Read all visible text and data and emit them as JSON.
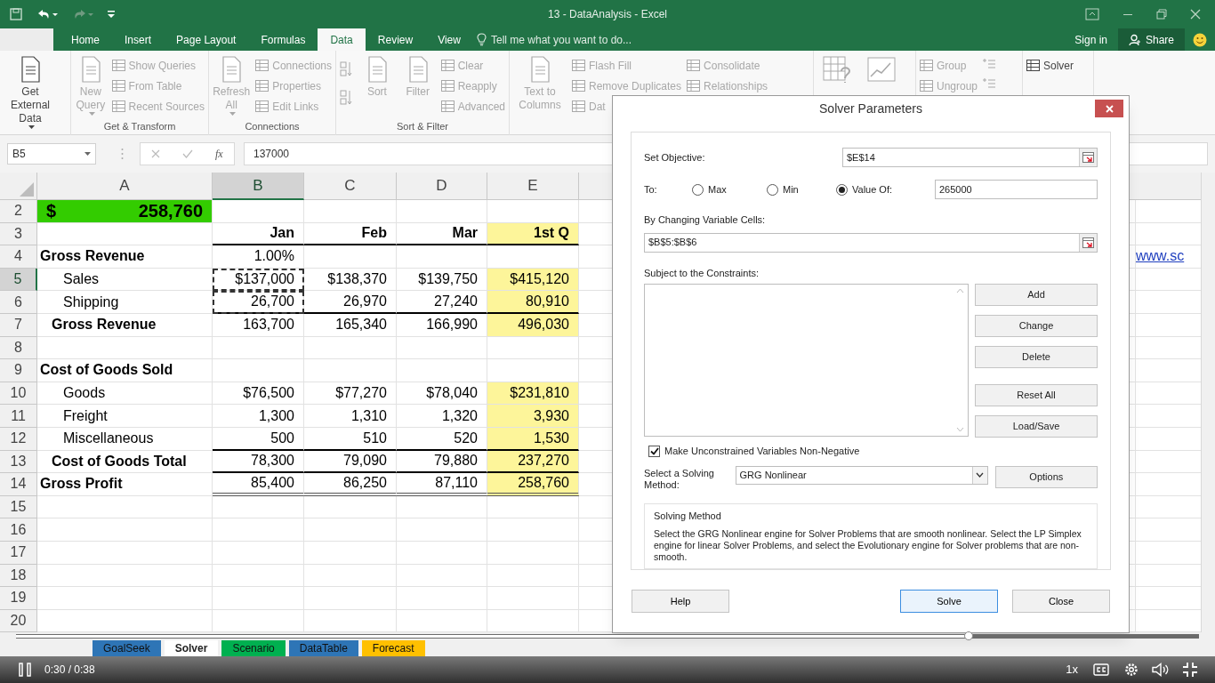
{
  "window": {
    "title": "13 - DataAnalysis - Excel"
  },
  "ribbon_tabs": [
    {
      "label": "Home",
      "selected": false
    },
    {
      "label": "Insert",
      "selected": false
    },
    {
      "label": "Page Layout",
      "selected": false
    },
    {
      "label": "Formulas",
      "selected": false
    },
    {
      "label": "Data",
      "selected": true
    },
    {
      "label": "Review",
      "selected": false
    },
    {
      "label": "View",
      "selected": false
    }
  ],
  "tell_me": "Tell me what you want to do...",
  "sign_in": "Sign in",
  "share": "Share",
  "ribbon_groups": [
    {
      "disabled": false,
      "items": [
        {
          "kind": "large",
          "text": "Get External Data",
          "menu": true
        }
      ]
    },
    {
      "label": "Get & Transform",
      "disabled": true,
      "items": [
        {
          "kind": "large",
          "text": "New Query",
          "menu": true
        },
        {
          "kind": "column",
          "entries": [
            "Show Queries",
            "From Table",
            "Recent Sources"
          ]
        }
      ]
    },
    {
      "label": "Connections",
      "disabled": true,
      "items": [
        {
          "kind": "large",
          "text": "Refresh All",
          "menu": true
        },
        {
          "kind": "column",
          "entries": [
            "Connections",
            "Properties",
            "Edit Links"
          ]
        }
      ]
    },
    {
      "label": "Sort & Filter",
      "disabled": true,
      "items": [
        {
          "kind": "sort_icons"
        },
        {
          "kind": "large",
          "text": "Sort",
          "menu": false
        },
        {
          "kind": "large",
          "text": "Filter",
          "menu": false
        },
        {
          "kind": "column",
          "entries": [
            "Clear",
            "Reapply",
            "Advanced"
          ]
        }
      ]
    },
    {
      "disabled": true,
      "items": [
        {
          "kind": "large",
          "text": "Text to Columns",
          "menu": false
        },
        {
          "kind": "column",
          "entries": [
            "Flash Fill",
            "Remove Duplicates",
            "Dat"
          ]
        },
        {
          "kind": "column",
          "entries": [
            "Consolidate",
            "Relationships"
          ]
        }
      ]
    },
    {
      "disabled": true,
      "items": [
        {
          "kind": "chart_icons"
        }
      ]
    },
    {
      "disabled": true,
      "items": [
        {
          "kind": "column",
          "entries": [
            "Group",
            "Ungroup"
          ]
        },
        {
          "kind": "outline_icons"
        }
      ]
    },
    {
      "disabled": false,
      "items": [
        {
          "kind": "column",
          "entries": [
            "Solver"
          ]
        }
      ]
    }
  ],
  "name_box": "B5",
  "function_button": "fx",
  "formula": "137000",
  "columns": [
    {
      "label": "A",
      "selected": false
    },
    {
      "label": "B",
      "selected": true
    },
    {
      "label": "C",
      "selected": false
    },
    {
      "label": "D",
      "selected": false
    },
    {
      "label": "E",
      "selected": false
    }
  ],
  "rows": [
    {
      "number": "2",
      "selected": false,
      "kind": "kpi",
      "highlight": false,
      "marked": false,
      "underline": false,
      "double": false,
      "cells": [
        {
          "sym": "$",
          "v": "258,760"
        }
      ]
    },
    {
      "number": "3",
      "selected": false,
      "kind": "header",
      "highlight": true,
      "marked": false,
      "underline": true,
      "double": false,
      "cells": [
        "",
        "Jan",
        "Feb",
        "Mar",
        "1st Q"
      ]
    },
    {
      "number": "4",
      "selected": false,
      "kind": "section",
      "highlight": false,
      "marked": false,
      "underline": false,
      "double": false,
      "link": "www.sc",
      "cells": [
        "Gross Revenue",
        "1.00%",
        "",
        "",
        ""
      ]
    },
    {
      "number": "5",
      "selected": true,
      "kind": "item",
      "highlight": true,
      "marked": true,
      "underline": false,
      "double": false,
      "cells": [
        "Sales",
        {
          "sym": "$",
          "v": "137,000"
        },
        {
          "sym": "$",
          "v": "138,370"
        },
        {
          "sym": "$",
          "v": "139,750"
        },
        {
          "sym": "$",
          "v": "415,120"
        }
      ]
    },
    {
      "number": "6",
      "selected": false,
      "kind": "item",
      "highlight": true,
      "marked": true,
      "underline": true,
      "double": false,
      "cells": [
        "Shipping",
        "26,700",
        "26,970",
        "27,240",
        "80,910"
      ]
    },
    {
      "number": "7",
      "selected": false,
      "kind": "total",
      "highlight": true,
      "marked": false,
      "underline": false,
      "double": false,
      "cells": [
        "Gross Revenue",
        "163,700",
        "165,340",
        "166,990",
        "496,030"
      ]
    },
    {
      "number": "8",
      "selected": false,
      "kind": "item",
      "highlight": false,
      "marked": false,
      "underline": false,
      "double": false,
      "cells": []
    },
    {
      "number": "9",
      "selected": false,
      "kind": "section",
      "highlight": false,
      "marked": false,
      "underline": false,
      "double": false,
      "cells": [
        "Cost of Goods Sold"
      ]
    },
    {
      "number": "10",
      "selected": false,
      "kind": "item",
      "highlight": true,
      "marked": false,
      "underline": false,
      "double": false,
      "cells": [
        "Goods",
        {
          "sym": "$",
          "v": "76,500"
        },
        {
          "sym": "$",
          "v": "77,270"
        },
        {
          "sym": "$",
          "v": "78,040"
        },
        {
          "sym": "$",
          "v": "231,810"
        }
      ]
    },
    {
      "number": "11",
      "selected": false,
      "kind": "item",
      "highlight": true,
      "marked": false,
      "underline": false,
      "double": false,
      "cells": [
        "Freight",
        "1,300",
        "1,310",
        "1,320",
        "3,930"
      ]
    },
    {
      "number": "12",
      "selected": false,
      "kind": "item",
      "highlight": true,
      "marked": false,
      "underline": true,
      "double": false,
      "cells": [
        "Miscellaneous",
        "500",
        "510",
        "520",
        "1,530"
      ]
    },
    {
      "number": "13",
      "selected": false,
      "kind": "total",
      "highlight": true,
      "marked": false,
      "underline": true,
      "double": false,
      "cells": [
        "Cost of Goods Total",
        "78,300",
        "79,090",
        "79,880",
        "237,270"
      ]
    },
    {
      "number": "14",
      "selected": false,
      "kind": "section",
      "highlight": true,
      "marked": false,
      "underline": true,
      "double": true,
      "cells": [
        "Gross Profit",
        "85,400",
        "86,250",
        "87,110",
        "258,760"
      ]
    },
    {
      "number": "15",
      "selected": false,
      "kind": "item",
      "highlight": false,
      "marked": false,
      "underline": false,
      "double": false,
      "cells": []
    },
    {
      "number": "16",
      "selected": false,
      "kind": "item",
      "highlight": false,
      "marked": false,
      "underline": false,
      "double": false,
      "cells": []
    },
    {
      "number": "17",
      "selected": false,
      "kind": "item",
      "highlight": false,
      "marked": false,
      "underline": false,
      "double": false,
      "cells": []
    },
    {
      "number": "18",
      "selected": false,
      "kind": "item",
      "highlight": false,
      "marked": false,
      "underline": false,
      "double": false,
      "cells": []
    },
    {
      "number": "19",
      "selected": false,
      "kind": "item",
      "highlight": false,
      "marked": false,
      "underline": false,
      "double": false,
      "cells": []
    },
    {
      "number": "20",
      "selected": false,
      "kind": "item",
      "highlight": false,
      "marked": false,
      "underline": false,
      "double": false,
      "cells": []
    }
  ],
  "sheet_tabs": [
    {
      "label": "GoalSeek",
      "selected": false,
      "color": "#2e75b6"
    },
    {
      "label": "Solver",
      "selected": true
    },
    {
      "label": "Scenario",
      "selected": false,
      "color": "#00b050"
    },
    {
      "label": "DataTable",
      "selected": false,
      "color": "#2e75b6"
    },
    {
      "label": "Forecast",
      "selected": false,
      "color": "#ffc000"
    }
  ],
  "dialog": {
    "title": "Solver Parameters",
    "objective_label": "Set Objective:",
    "objective": "$E$14",
    "to_label": "To:",
    "targets": [
      {
        "label": "Max",
        "selected": false
      },
      {
        "label": "Min",
        "selected": false
      },
      {
        "label": "Value Of:",
        "selected": true
      }
    ],
    "target_value": "265000",
    "variables_label": "By Changing Variable Cells:",
    "variables": "$B$5:$B$6",
    "constraints_label": "Subject to the Constraints:",
    "constraint_buttons": [
      "Add",
      "Change",
      "Delete",
      "Reset All",
      "Load/Save"
    ],
    "nonnegative": {
      "label": "Make Unconstrained Variables Non-Negative",
      "checked": true
    },
    "method_label": "Select a Solving Method:",
    "method": "GRG Nonlinear",
    "options_button": "Options",
    "method_box": {
      "title": "Solving Method",
      "text": "Select the GRG Nonlinear engine for Solver Problems that are smooth nonlinear. Select the LP Simplex engine for linear Solver Problems, and select the Evolutionary engine for Solver problems that are non-smooth."
    },
    "buttons": [
      {
        "label": "Help",
        "focused": false
      },
      {
        "label": "Solve",
        "focused": true
      },
      {
        "label": "Close",
        "focused": false
      }
    ]
  },
  "player": {
    "playing": true,
    "level": 0.805,
    "time": "0:30 / 0:38",
    "speed": "1x"
  }
}
